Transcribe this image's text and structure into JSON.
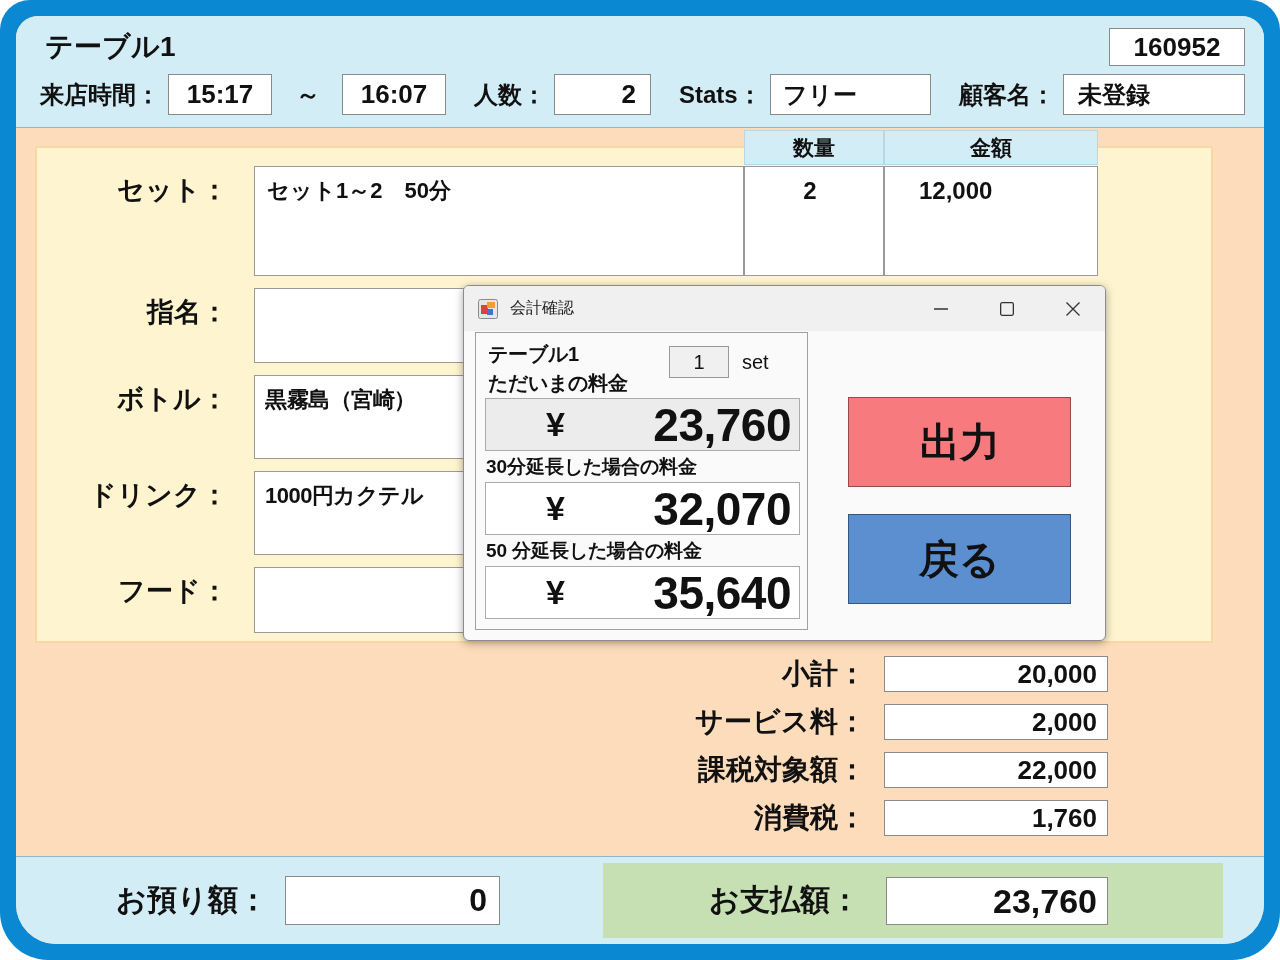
{
  "header": {
    "title": "テーブル1",
    "number": "160952",
    "visit_time": {
      "label": "来店時間：",
      "start": "15:17",
      "separator": "～",
      "end": "16:07"
    },
    "guests": {
      "label": "人数：",
      "value": "2"
    },
    "stats": {
      "label": "Stats：",
      "value": "フリー"
    },
    "customer": {
      "label": "顧客名：",
      "value": "未登録"
    }
  },
  "order": {
    "columns": [
      "数量",
      "金額"
    ],
    "rows": [
      {
        "kind": "set",
        "label": "セット：",
        "item": "セット1～2　50分",
        "quantity": "2",
        "amount": "12,000"
      },
      {
        "kind": "line",
        "label": "指名："
      },
      {
        "kind": "line",
        "label": "ボトル：",
        "item": "黒霧島（宮崎）"
      },
      {
        "kind": "line",
        "label": "ドリンク：",
        "item": "1000円カクテル"
      },
      {
        "kind": "line",
        "label": "フード："
      }
    ]
  },
  "dialog": {
    "title": "会計確認",
    "table_name": "テーブル1",
    "set_count": "1",
    "set_unit": "set",
    "prices": [
      {
        "label": "ただいまの料金",
        "currency": "¥",
        "amount": "23,760",
        "highlighted": true
      },
      {
        "label": "30分延長した場合の料金",
        "currency": "¥",
        "amount": "32,070",
        "highlighted": false
      },
      {
        "label": "50 分延長した場合の料金",
        "currency": "¥",
        "amount": "35,640",
        "highlighted": false
      }
    ],
    "buttons": [
      {
        "label": "出力",
        "color": "#f77b7e"
      },
      {
        "label": "戻る",
        "color": "#5b8fd0"
      }
    ]
  },
  "summary": [
    {
      "label": "小計：",
      "value": "20,000"
    },
    {
      "label": "サービス料：",
      "value": "2,000"
    },
    {
      "label": "課税対象額：",
      "value": "22,000"
    },
    {
      "label": "消費税：",
      "value": "1,760"
    }
  ],
  "footer": {
    "deposit": {
      "label": "お預り額：",
      "value": "0"
    },
    "payment": {
      "label": "お支払額：",
      "value": "23,760"
    }
  }
}
